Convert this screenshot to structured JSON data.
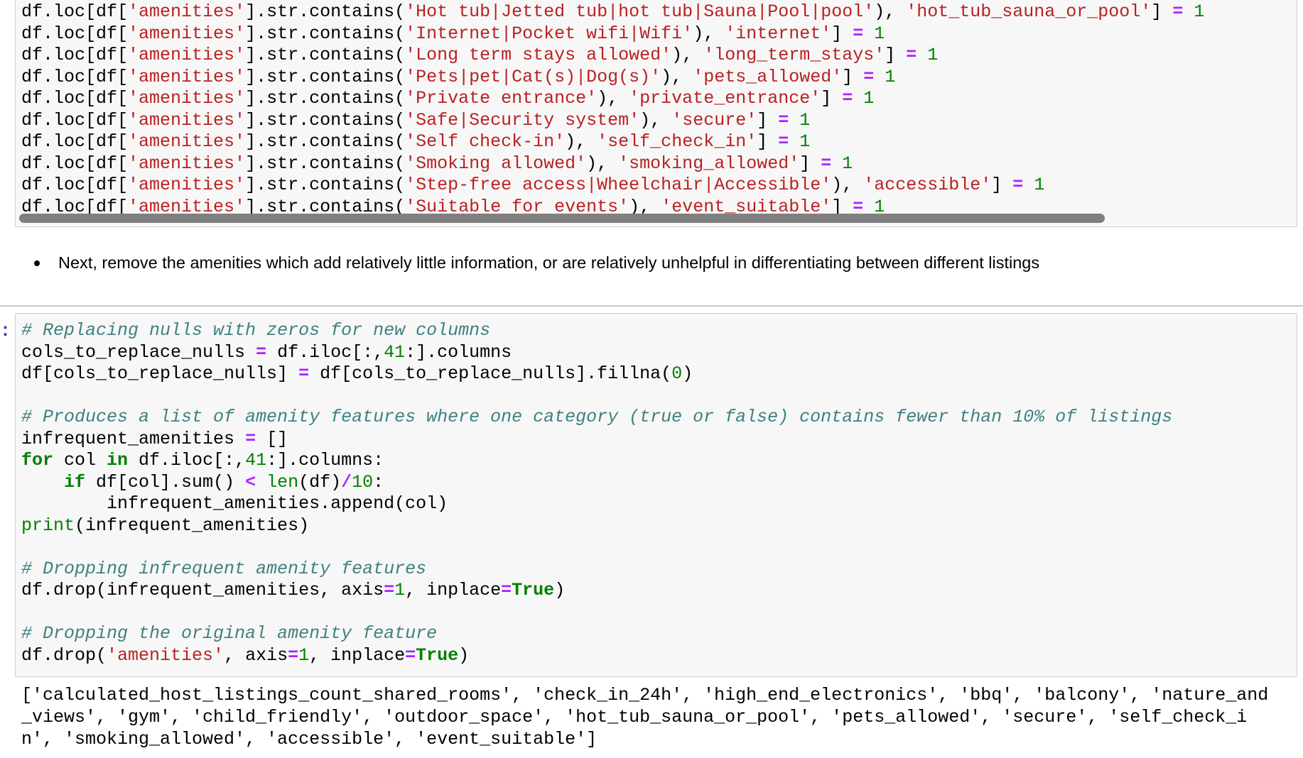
{
  "cell1": {
    "lines": [
      [
        [
          "p",
          "df.loc[df["
        ],
        [
          "s",
          "'amenities'"
        ],
        [
          "p",
          "].str.contains("
        ],
        [
          "s",
          "'Hot tub|Jetted tub|hot tub|Sauna|Pool|pool'"
        ],
        [
          "p",
          "), "
        ],
        [
          "s",
          "'hot_tub_sauna_or_pool'"
        ],
        [
          "p",
          "] "
        ],
        [
          "o",
          "="
        ],
        [
          "p",
          " "
        ],
        [
          "n",
          "1"
        ]
      ],
      [
        [
          "p",
          "df.loc[df["
        ],
        [
          "s",
          "'amenities'"
        ],
        [
          "p",
          "].str.contains("
        ],
        [
          "s",
          "'Internet|Pocket wifi|Wifi'"
        ],
        [
          "p",
          "), "
        ],
        [
          "s",
          "'internet'"
        ],
        [
          "p",
          "] "
        ],
        [
          "o",
          "="
        ],
        [
          "p",
          " "
        ],
        [
          "n",
          "1"
        ]
      ],
      [
        [
          "p",
          "df.loc[df["
        ],
        [
          "s",
          "'amenities'"
        ],
        [
          "p",
          "].str.contains("
        ],
        [
          "s",
          "'Long term stays allowed'"
        ],
        [
          "p",
          "), "
        ],
        [
          "s",
          "'long_term_stays'"
        ],
        [
          "p",
          "] "
        ],
        [
          "o",
          "="
        ],
        [
          "p",
          " "
        ],
        [
          "n",
          "1"
        ]
      ],
      [
        [
          "p",
          "df.loc[df["
        ],
        [
          "s",
          "'amenities'"
        ],
        [
          "p",
          "].str.contains("
        ],
        [
          "s",
          "'Pets|pet|Cat(s)|Dog(s)'"
        ],
        [
          "p",
          "), "
        ],
        [
          "s",
          "'pets_allowed'"
        ],
        [
          "p",
          "] "
        ],
        [
          "o",
          "="
        ],
        [
          "p",
          " "
        ],
        [
          "n",
          "1"
        ]
      ],
      [
        [
          "p",
          "df.loc[df["
        ],
        [
          "s",
          "'amenities'"
        ],
        [
          "p",
          "].str.contains("
        ],
        [
          "s",
          "'Private entrance'"
        ],
        [
          "p",
          "), "
        ],
        [
          "s",
          "'private_entrance'"
        ],
        [
          "p",
          "] "
        ],
        [
          "o",
          "="
        ],
        [
          "p",
          " "
        ],
        [
          "n",
          "1"
        ]
      ],
      [
        [
          "p",
          "df.loc[df["
        ],
        [
          "s",
          "'amenities'"
        ],
        [
          "p",
          "].str.contains("
        ],
        [
          "s",
          "'Safe|Security system'"
        ],
        [
          "p",
          "), "
        ],
        [
          "s",
          "'secure'"
        ],
        [
          "p",
          "] "
        ],
        [
          "o",
          "="
        ],
        [
          "p",
          " "
        ],
        [
          "n",
          "1"
        ]
      ],
      [
        [
          "p",
          "df.loc[df["
        ],
        [
          "s",
          "'amenities'"
        ],
        [
          "p",
          "].str.contains("
        ],
        [
          "s",
          "'Self check-in'"
        ],
        [
          "p",
          "), "
        ],
        [
          "s",
          "'self_check_in'"
        ],
        [
          "p",
          "] "
        ],
        [
          "o",
          "="
        ],
        [
          "p",
          " "
        ],
        [
          "n",
          "1"
        ]
      ],
      [
        [
          "p",
          "df.loc[df["
        ],
        [
          "s",
          "'amenities'"
        ],
        [
          "p",
          "].str.contains("
        ],
        [
          "s",
          "'Smoking allowed'"
        ],
        [
          "p",
          "), "
        ],
        [
          "s",
          "'smoking_allowed'"
        ],
        [
          "p",
          "] "
        ],
        [
          "o",
          "="
        ],
        [
          "p",
          " "
        ],
        [
          "n",
          "1"
        ]
      ],
      [
        [
          "p",
          "df.loc[df["
        ],
        [
          "s",
          "'amenities'"
        ],
        [
          "p",
          "].str.contains("
        ],
        [
          "s",
          "'Step-free access|Wheelchair|Accessible'"
        ],
        [
          "p",
          "), "
        ],
        [
          "s",
          "'accessible'"
        ],
        [
          "p",
          "] "
        ],
        [
          "o",
          "="
        ],
        [
          "p",
          " "
        ],
        [
          "n",
          "1"
        ]
      ],
      [
        [
          "p",
          "df.loc[df["
        ],
        [
          "s",
          "'amenities'"
        ],
        [
          "p",
          "].str.contains("
        ],
        [
          "s",
          "'Suitable for events'"
        ],
        [
          "p",
          "), "
        ],
        [
          "s",
          "'event_suitable'"
        ],
        [
          "p",
          "] "
        ],
        [
          "o",
          "="
        ],
        [
          "p",
          " "
        ],
        [
          "n",
          "1"
        ]
      ]
    ]
  },
  "markdown": {
    "bullet": "Next, remove the amenities which add relatively little information, or are relatively unhelpful in differentiating between different listings"
  },
  "cell2": {
    "prompt": ":",
    "lines": [
      [
        [
          "c",
          "# Replacing nulls with zeros for new columns"
        ]
      ],
      [
        [
          "p",
          "cols_to_replace_nulls "
        ],
        [
          "o",
          "="
        ],
        [
          "p",
          " df.iloc[:,"
        ],
        [
          "n",
          "41"
        ],
        [
          "p",
          ":].columns"
        ]
      ],
      [
        [
          "p",
          "df[cols_to_replace_nulls] "
        ],
        [
          "o",
          "="
        ],
        [
          "p",
          " df[cols_to_replace_nulls].fillna("
        ],
        [
          "n",
          "0"
        ],
        [
          "p",
          ")"
        ]
      ],
      [],
      [
        [
          "c",
          "# Produces a list of amenity features where one category (true or false) contains fewer than 10% of listings"
        ]
      ],
      [
        [
          "p",
          "infrequent_amenities "
        ],
        [
          "o",
          "="
        ],
        [
          "p",
          " []"
        ]
      ],
      [
        [
          "k",
          "for"
        ],
        [
          "p",
          " col "
        ],
        [
          "k",
          "in"
        ],
        [
          "p",
          " df.iloc[:,"
        ],
        [
          "n",
          "41"
        ],
        [
          "p",
          ":].columns:"
        ]
      ],
      [
        [
          "p",
          "    "
        ],
        [
          "k",
          "if"
        ],
        [
          "p",
          " df[col].sum() "
        ],
        [
          "o",
          "<"
        ],
        [
          "p",
          " "
        ],
        [
          "b",
          "len"
        ],
        [
          "p",
          "(df)"
        ],
        [
          "o",
          "/"
        ],
        [
          "n",
          "10"
        ],
        [
          "p",
          ":"
        ]
      ],
      [
        [
          "p",
          "        infrequent_amenities.append(col)"
        ]
      ],
      [
        [
          "b",
          "print"
        ],
        [
          "p",
          "(infrequent_amenities)"
        ]
      ],
      [],
      [
        [
          "c",
          "# Dropping infrequent amenity features"
        ]
      ],
      [
        [
          "p",
          "df.drop(infrequent_amenities, axis"
        ],
        [
          "o",
          "="
        ],
        [
          "n",
          "1"
        ],
        [
          "p",
          ", inplace"
        ],
        [
          "o",
          "="
        ],
        [
          "k",
          "True"
        ],
        [
          "p",
          ")"
        ]
      ],
      [],
      [
        [
          "c",
          "# Dropping the original amenity feature"
        ]
      ],
      [
        [
          "p",
          "df.drop("
        ],
        [
          "s",
          "'amenities'"
        ],
        [
          "p",
          ", axis"
        ],
        [
          "o",
          "="
        ],
        [
          "n",
          "1"
        ],
        [
          "p",
          ", inplace"
        ],
        [
          "o",
          "="
        ],
        [
          "k",
          "True"
        ],
        [
          "p",
          ")"
        ]
      ]
    ],
    "output": "['calculated_host_listings_count_shared_rooms', 'check_in_24h', 'high_end_electronics', 'bbq', 'balcony', 'nature_and_views', 'gym', 'child_friendly', 'outdoor_space', 'hot_tub_sauna_or_pool', 'pets_allowed', 'secure', 'self_check_in', 'smoking_allowed', 'accessible', 'event_suitable']"
  },
  "colors": {
    "string": "#BA2121",
    "keyword": "#008000",
    "number": "#008000",
    "operator": "#AA22FF",
    "comment": "#408080",
    "prompt": "#303F9F"
  }
}
